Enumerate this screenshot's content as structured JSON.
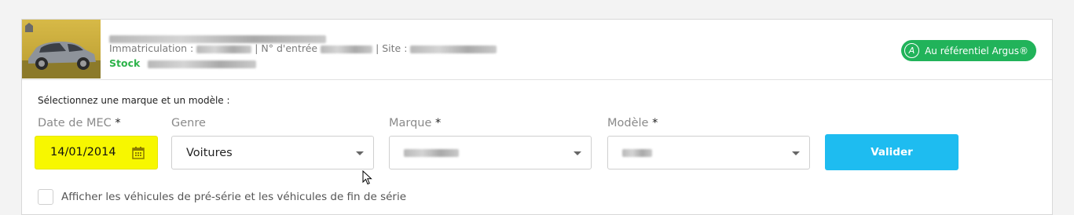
{
  "vehicle": {
    "immat_label": "Immatriculation : ",
    "entry_label": " | N° d'entrée ",
    "site_label": " | Site : ",
    "stock_label": "Stock",
    "argus_icon_letter": "A",
    "argus_button": "Au référentiel Argus®"
  },
  "form": {
    "section_title": "Sélectionnez une marque et un modèle :",
    "date_label": "Date de MEC",
    "date_value": "14/01/2014",
    "genre_label": "Genre",
    "genre_value": "Voitures",
    "marque_label": "Marque",
    "modele_label": "Modèle",
    "required_mark": "*",
    "submit_label": "Valider",
    "checkbox_label": "Afficher les véhicules de pré-série et les véhicules de fin de série"
  },
  "icons": {
    "calendar": "calendar-icon",
    "dropdown": "chevron-down-icon",
    "argus": "argus-logo-icon"
  },
  "colors": {
    "stock_green": "#2db34a",
    "argus_green": "#21b35a",
    "submit_blue": "#1ebcf0",
    "date_highlight": "#f7f700"
  }
}
